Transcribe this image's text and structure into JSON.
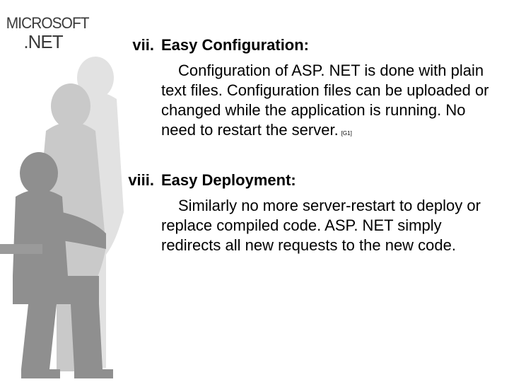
{
  "logo": {
    "line1": "MICROSOFT",
    "line2": ".NET"
  },
  "items": [
    {
      "marker": "vii.",
      "title": "Easy Configuration:",
      "body": "Configuration of ASP. NET is done with plain text files. Configuration files can be uploaded or changed while the application is running. No need to restart the server.",
      "citation": "[G1]"
    },
    {
      "marker": "viii.",
      "title": "Easy Deployment:",
      "body": "Similarly no more server-restart to deploy or replace compiled code. ASP. NET simply redirects all new requests to the new code.",
      "citation": ""
    }
  ]
}
